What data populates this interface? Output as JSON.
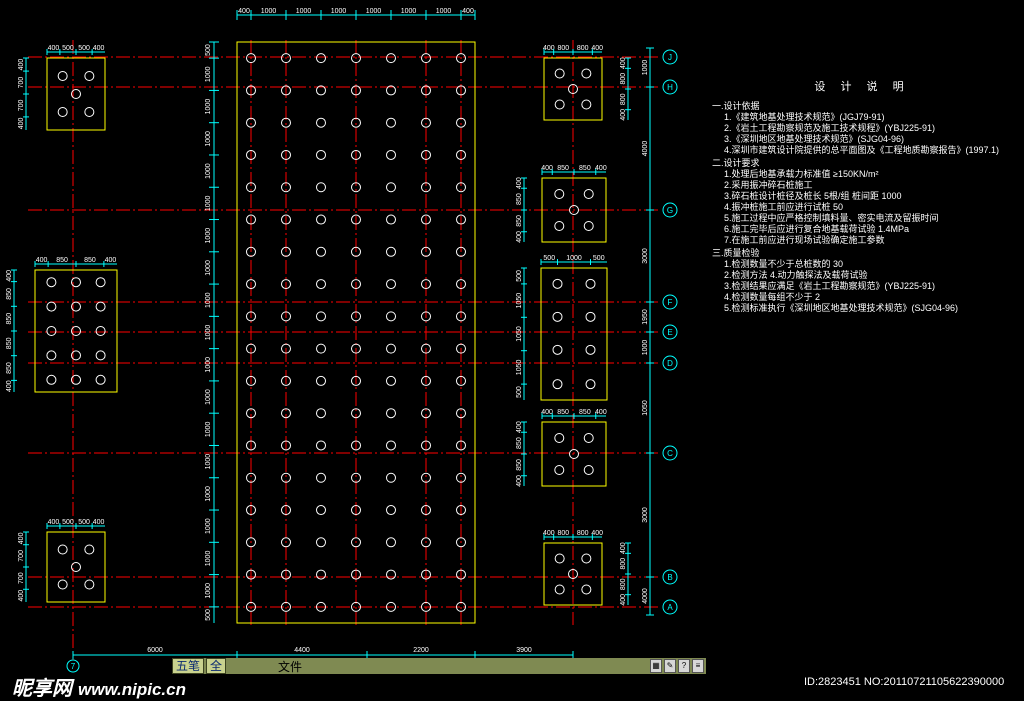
{
  "colors": {
    "background": "#000000",
    "axis": "#ff0000",
    "outline": "#ffff00",
    "pile": "#ffffff",
    "dimension": "#00ffff",
    "text": "#ffffff"
  },
  "raft": {
    "top_dims": [
      "400",
      "1000",
      "1000",
      "1000",
      "1000",
      "1000",
      "1000",
      "400"
    ],
    "left_dims": [
      "500",
      "1000",
      "1000",
      "1000",
      "1000",
      "1000",
      "1000",
      "1000",
      "1000",
      "1000",
      "1000",
      "1000",
      "1000",
      "1000",
      "1000",
      "1000",
      "1000",
      "1000",
      "500"
    ],
    "pile_cols": 8,
    "pile_rows": 19
  },
  "axis_labels": [
    "J",
    "H",
    "G",
    "F",
    "E",
    "D",
    "C",
    "B",
    "A"
  ],
  "bottom_axis_label": "7",
  "right_dims": [
    "1000",
    "4000",
    "3000",
    "1950",
    "1000",
    "1050",
    "3000",
    "4000",
    "1000"
  ],
  "bottom_dims": [
    "6000",
    "4400",
    "2200",
    "3900"
  ],
  "caps_left": [
    {
      "top_dims": [
        "400",
        "500",
        "500",
        "400"
      ],
      "side_dims": [
        "400",
        "700",
        "700",
        "400"
      ]
    },
    {
      "top_dims": [
        "400",
        "850",
        "850",
        "400"
      ],
      "side_dims": [
        "400",
        "850",
        "850",
        "850",
        "850",
        "400"
      ]
    },
    {
      "top_dims": [
        "400",
        "500",
        "500",
        "400"
      ],
      "side_dims": [
        "400",
        "700",
        "700",
        "400"
      ]
    }
  ],
  "caps_right": [
    {
      "top_dims": [
        "400",
        "800",
        "800",
        "400"
      ],
      "side_dims": [
        "400",
        "800",
        "800",
        "400"
      ]
    },
    {
      "top_dims": [
        "400",
        "850",
        "850",
        "400"
      ],
      "side_dims": [
        "400",
        "850",
        "850",
        "400"
      ]
    },
    {
      "top_dims": [
        "500",
        "1000",
        "500"
      ],
      "side_dims": [
        "500",
        "1050",
        "1050",
        "1050",
        "500"
      ]
    },
    {
      "top_dims": [
        "400",
        "850",
        "850",
        "400"
      ],
      "side_dims": [
        "400",
        "850",
        "850",
        "400"
      ]
    },
    {
      "top_dims": [
        "400",
        "800",
        "800",
        "400"
      ],
      "side_dims": [
        "400",
        "800",
        "800",
        "400"
      ]
    }
  ],
  "notes": {
    "title": "设 计 说 明",
    "sections": [
      {
        "heading": "一.设计依据",
        "items": [
          "1.《建筑地基处理技术规范》(JGJ79-91)",
          "2.《岩土工程勘察规范及施工技术规程》(YBJ225-91)",
          "3.《深圳地区地基处理技术规范》(SJG04-96)",
          "4.深圳市建筑设计院提供的总平面图及《工程地质勘察报告》(1997.1)"
        ]
      },
      {
        "heading": "二.设计要求",
        "items": [
          "1.处理后地基承载力标准值 ≥150KN/m²",
          "2.采用振冲碎石桩施工",
          "3.碎石桩设计桩径及桩长 5根/组 桩间距 1000",
          "4.振冲桩施工前应进行试桩 50",
          "5.施工过程中应严格控制填料量、密实电流及留振时间",
          "6.施工完毕后应进行复合地基载荷试验 1.4MPa",
          "7.在施工前应进行现场试验确定施工参数"
        ]
      },
      {
        "heading": "三.质量检验",
        "items": [
          "1.检测数量不少于总桩数的 30",
          "2.检测方法 4.动力触探法及载荷试验",
          "3.检测结果应满足《岩土工程勘察规范》(YBJ225-91)",
          "4.检测数量每组不少于 2",
          "5.检测标准执行《深圳地区地基处理技术规范》(SJG04-96)"
        ]
      }
    ]
  },
  "statusbar": {
    "wubi": "五笔",
    "full": "全",
    "file": "文件"
  },
  "watermark": {
    "logo": "昵享网",
    "url": "www.nipic.cn",
    "id_text": "ID:2823451 NO:20110721105622390000"
  }
}
